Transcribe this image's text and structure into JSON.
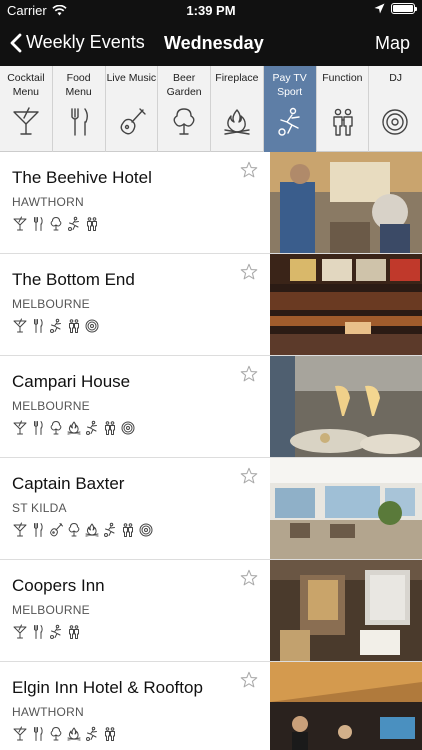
{
  "status": {
    "carrier": "Carrier",
    "time": "1:39 PM"
  },
  "nav": {
    "back_label": "Weekly Events",
    "title": "Wednesday",
    "map_label": "Map"
  },
  "categories": [
    {
      "label": "Cocktail Menu",
      "icon": "cocktail-icon"
    },
    {
      "label": "Food Menu",
      "icon": "fork-knife-icon"
    },
    {
      "label": "Live Music",
      "icon": "guitar-icon"
    },
    {
      "label": "Beer Garden",
      "icon": "tree-icon"
    },
    {
      "label": "Fireplace",
      "icon": "fire-icon"
    },
    {
      "label": "Pay TV Sport",
      "icon": "soccer-player-icon",
      "active": true
    },
    {
      "label": "Function",
      "icon": "people-icon"
    },
    {
      "label": "DJ",
      "icon": "vinyl-record-icon"
    }
  ],
  "active_color": "#5e7ea6",
  "venues": [
    {
      "name": "The Beehive Hotel",
      "suburb": "HAWTHORN",
      "amenities": [
        "cocktail-icon",
        "fork-knife-icon",
        "tree-icon",
        "soccer-player-icon",
        "people-icon"
      ]
    },
    {
      "name": "The Bottom End",
      "suburb": "MELBOURNE",
      "amenities": [
        "cocktail-icon",
        "fork-knife-icon",
        "soccer-player-icon",
        "people-icon",
        "vinyl-record-icon"
      ]
    },
    {
      "name": "Campari House",
      "suburb": "MELBOURNE",
      "amenities": [
        "cocktail-icon",
        "fork-knife-icon",
        "tree-icon",
        "fire-icon",
        "soccer-player-icon",
        "people-icon",
        "vinyl-record-icon"
      ]
    },
    {
      "name": "Captain Baxter",
      "suburb": "ST KILDA",
      "amenities": [
        "cocktail-icon",
        "fork-knife-icon",
        "guitar-icon",
        "tree-icon",
        "fire-icon",
        "soccer-player-icon",
        "people-icon",
        "vinyl-record-icon"
      ]
    },
    {
      "name": "Coopers Inn",
      "suburb": "MELBOURNE",
      "amenities": [
        "cocktail-icon",
        "fork-knife-icon",
        "soccer-player-icon",
        "people-icon"
      ]
    },
    {
      "name": "Elgin Inn Hotel & Rooftop",
      "suburb": "HAWTHORN",
      "amenities": [
        "cocktail-icon",
        "fork-knife-icon",
        "tree-icon",
        "fire-icon",
        "soccer-player-icon",
        "people-icon"
      ]
    }
  ]
}
